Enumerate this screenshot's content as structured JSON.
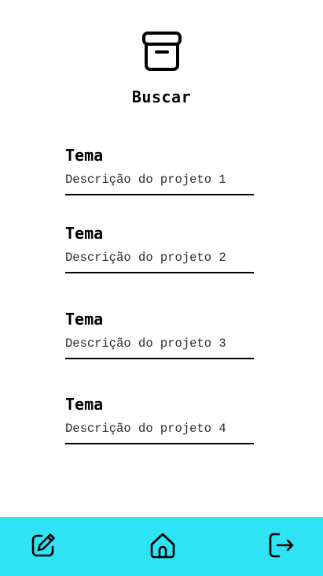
{
  "header": {
    "icon": "archive-icon",
    "title": "Buscar"
  },
  "projects": [
    {
      "theme": "Tema",
      "description": "Descrição do projeto 1"
    },
    {
      "theme": "Tema",
      "description": "Descrição do projeto 2"
    },
    {
      "theme": "Tema",
      "description": "Descrição do projeto 3"
    },
    {
      "theme": "Tema",
      "description": "Descrição do projeto 4"
    }
  ],
  "bottom_nav": {
    "background": "#2ee4f4",
    "items": [
      {
        "icon": "edit-icon"
      },
      {
        "icon": "home-icon"
      },
      {
        "icon": "logout-icon"
      }
    ]
  }
}
